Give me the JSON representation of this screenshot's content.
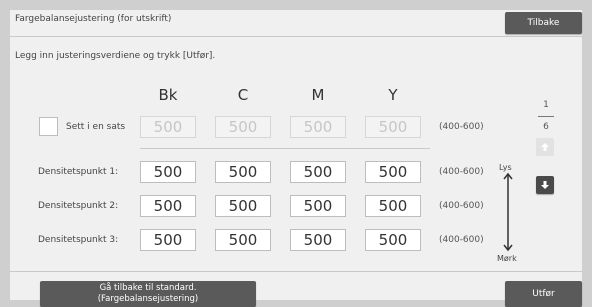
{
  "header": {
    "title": "Fargebalansejustering (for utskrift)",
    "back_label": "Tilbake"
  },
  "instruction": "Legg inn justeringsverdiene og trykk [Utfør].",
  "columns": [
    "Bk",
    "C",
    "M",
    "Y"
  ],
  "set_all": {
    "label": "Sett i en sats",
    "checked": false,
    "values": [
      "500",
      "500",
      "500",
      "500"
    ],
    "range": "(400-600)"
  },
  "rows": [
    {
      "label": "Densitetspunkt 1:",
      "values": [
        "500",
        "500",
        "500",
        "500"
      ],
      "range": "(400-600)"
    },
    {
      "label": "Densitetspunkt 2:",
      "values": [
        "500",
        "500",
        "500",
        "500"
      ],
      "range": "(400-600)"
    },
    {
      "label": "Densitetspunkt 3:",
      "values": [
        "500",
        "500",
        "500",
        "500"
      ],
      "range": "(400-600)"
    }
  ],
  "pager": {
    "current": "1",
    "total": "6"
  },
  "scale": {
    "light": "Lys",
    "dark": "Mørk"
  },
  "footer": {
    "reset_line1": "Gå tilbake til standard.",
    "reset_line2": "(Fargebalansejustering)",
    "execute_label": "Utfør"
  },
  "colors": {
    "button": "#5a5a5a",
    "panel": "#f0f0f0",
    "background": "#cfcfcf"
  }
}
